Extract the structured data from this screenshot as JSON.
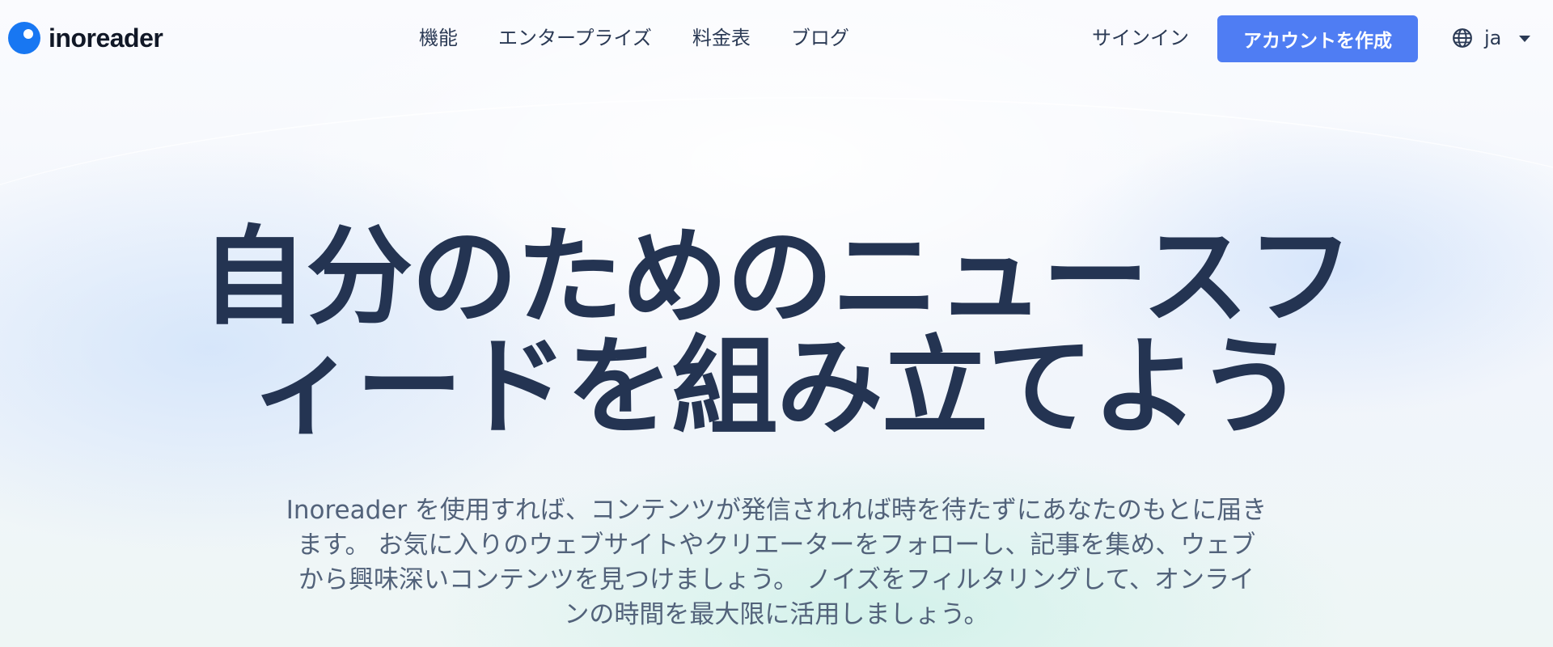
{
  "header": {
    "logo_text": "inoreader",
    "nav": [
      {
        "label": "機能"
      },
      {
        "label": "エンタープライズ"
      },
      {
        "label": "料金表"
      },
      {
        "label": "ブログ"
      }
    ],
    "signin_label": "サインイン",
    "create_account_label": "アカウントを作成",
    "language": "ja"
  },
  "hero": {
    "title_line1": "自分のためのニュースフ",
    "title_line2": "ィードを組み立てよう",
    "subtitle_line1": "Inoreader を使用すれば、コンテンツが発信されれば時を待たずにあなたのもとに届き",
    "subtitle_line2": "ます。 お気に入りのウェブサイトやクリエーターをフォローし、記事を集め、ウェブ",
    "subtitle_line3": "から興味深いコンテンツを見つけましょう。 ノイズをフィルタリングして、オンライ",
    "subtitle_line4": "ンの時間を最大限に活用しましょう。"
  },
  "colors": {
    "brand_blue": "#1877f2",
    "button_blue": "#4f7df3",
    "heading": "#243452",
    "body_text": "#52627a"
  },
  "icons": {
    "logo": "inoreader-logo-icon",
    "language": "globe-icon",
    "dropdown": "caret-down-icon"
  }
}
